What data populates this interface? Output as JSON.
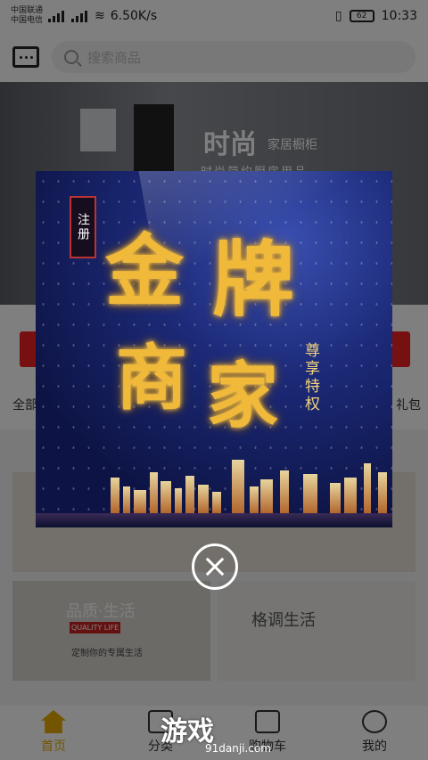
{
  "status": {
    "carrier1": "中国联通",
    "carrier2": "中国电信",
    "speed": "6.50K/s",
    "battery": "62",
    "time": "10:33"
  },
  "search": {
    "placeholder": "搜索商品"
  },
  "banner": {
    "title": "时尚",
    "subtitle": "家居橱柜",
    "tagline": "时尚简约厨房用品"
  },
  "categories": {
    "left": "全部",
    "right": "礼包"
  },
  "tiles": {
    "left_title": "品质·生活",
    "left_badge": "QUALITY LIFE",
    "left_sub": "定制你的专属生活",
    "right_title": "格调生活"
  },
  "popup": {
    "tag": "注册",
    "line1a": "金",
    "line1b": "牌",
    "line2a": "商",
    "line2b": "家",
    "subtitle": "尊享特权"
  },
  "nav": [
    {
      "label": "首页"
    },
    {
      "label": "分类"
    },
    {
      "label": "购物车"
    },
    {
      "label": "我的"
    }
  ],
  "watermark": {
    "text": "游戏",
    "site": "91danji.com"
  }
}
